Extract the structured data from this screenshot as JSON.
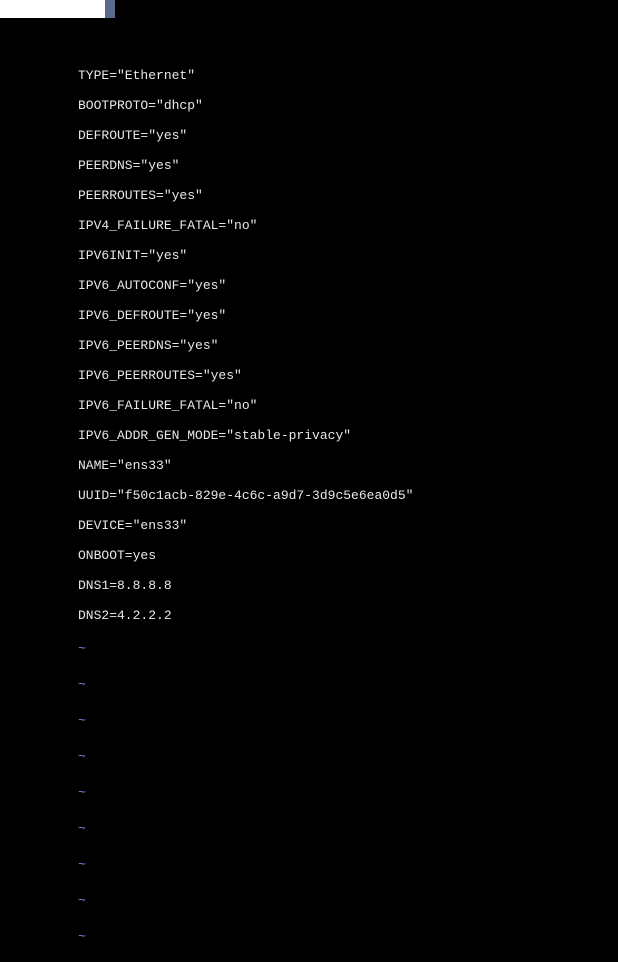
{
  "config_lines": [
    "TYPE=\"Ethernet\"",
    "BOOTPROTO=\"dhcp\"",
    "DEFROUTE=\"yes\"",
    "PEERDNS=\"yes\"",
    "PEERROUTES=\"yes\"",
    "IPV4_FAILURE_FATAL=\"no\"",
    "IPV6INIT=\"yes\"",
    "IPV6_AUTOCONF=\"yes\"",
    "IPV6_DEFROUTE=\"yes\"",
    "IPV6_PEERDNS=\"yes\"",
    "IPV6_PEERROUTES=\"yes\"",
    "IPV6_FAILURE_FATAL=\"no\"",
    "IPV6_ADDR_GEN_MODE=\"stable-privacy\"",
    "NAME=\"ens33\"",
    "UUID=\"f50c1acb-829e-4c6c-a9d7-3d9c5e6ea0d5\"",
    "DEVICE=\"ens33\"",
    "ONBOOT=yes",
    "DNS1=8.8.8.8",
    "DNS2=4.2.2.2"
  ],
  "tilde": "~",
  "tilde_count": 9
}
